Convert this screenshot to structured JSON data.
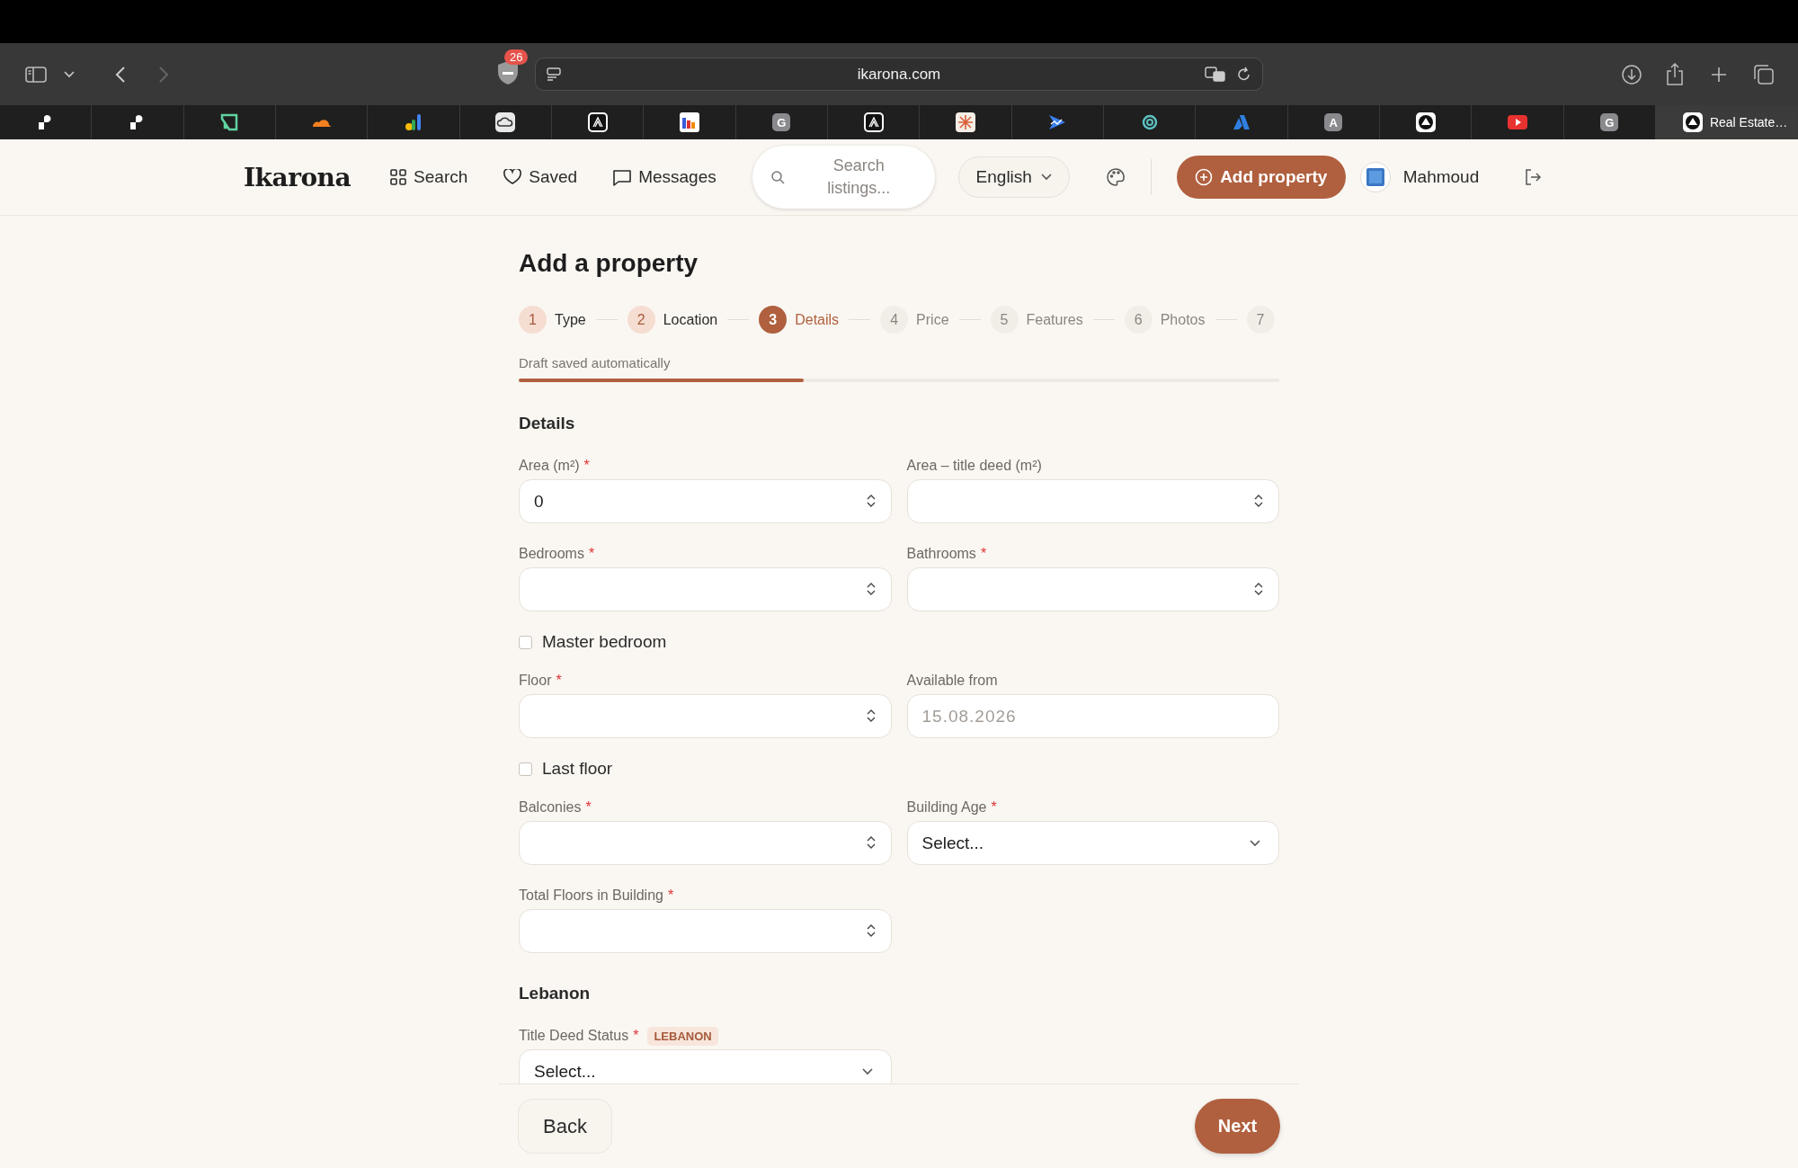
{
  "browser": {
    "address": "ikarona.com",
    "shield_badge": "26",
    "tabs": [
      {
        "kind": "blob",
        "selected": false
      },
      {
        "kind": "blob",
        "selected": false
      },
      {
        "kind": "green-square",
        "selected": false
      },
      {
        "kind": "orange-cloud",
        "selected": false
      },
      {
        "kind": "color-bars",
        "selected": false
      },
      {
        "kind": "cloud-box",
        "selected": false
      },
      {
        "kind": "mono-lines",
        "selected": false
      },
      {
        "kind": "bars-box",
        "selected": false
      },
      {
        "kind": "letter",
        "glyph": "G",
        "selected": false
      },
      {
        "kind": "mono-lines",
        "selected": false
      },
      {
        "kind": "spark",
        "selected": false
      },
      {
        "kind": "blue-arrow",
        "selected": false
      },
      {
        "kind": "teal-ring",
        "selected": false
      },
      {
        "kind": "blue-peak",
        "selected": false
      },
      {
        "kind": "letter",
        "glyph": "A",
        "selected": false
      },
      {
        "kind": "circle-triangle",
        "selected": false
      },
      {
        "kind": "play",
        "selected": false
      },
      {
        "kind": "letter",
        "glyph": "G",
        "selected": false
      },
      {
        "kind": "circle-triangle",
        "title": "Real Estate…",
        "selected": true
      }
    ]
  },
  "header": {
    "logo": "Ikarona",
    "nav": [
      {
        "kind": "grid",
        "label": "Search"
      },
      {
        "kind": "heart",
        "label": "Saved"
      },
      {
        "kind": "chat",
        "label": "Messages"
      }
    ],
    "search": {
      "placeholder": "Search listings..."
    },
    "language": "English",
    "add_button": "Add property",
    "user": "Mahmoud"
  },
  "page": {
    "title": "Add a property",
    "steps": [
      {
        "number": "1",
        "label": "Type",
        "completed": true,
        "selected": false
      },
      {
        "number": "2",
        "label": "Location",
        "completed": true,
        "selected": false
      },
      {
        "number": "3",
        "label": "Details",
        "completed": false,
        "selected": true
      },
      {
        "number": "4",
        "label": "Price",
        "completed": false,
        "selected": false
      },
      {
        "number": "5",
        "label": "Features",
        "completed": false,
        "selected": false
      },
      {
        "number": "6",
        "label": "Photos",
        "completed": false,
        "selected": false
      },
      {
        "number": "7",
        "completed": false,
        "selected": false
      }
    ],
    "draft_note": "Draft saved automatically",
    "progress": {
      "level": 0.375
    }
  },
  "sections": [
    {
      "title": "Details",
      "rows": [
        [
          {
            "kind": "number",
            "label": "Area (m²)",
            "required_mark": "*",
            "value": "0"
          },
          {
            "kind": "number",
            "label": "Area – title deed (m²)"
          }
        ],
        [
          {
            "kind": "number",
            "label": "Bedrooms",
            "required_mark": "*"
          },
          {
            "kind": "number",
            "label": "Bathrooms",
            "required_mark": "*"
          }
        ],
        [
          {
            "kind": "checkbox",
            "label": "Master bedroom",
            "checked": false
          }
        ],
        [
          {
            "kind": "number",
            "label": "Floor",
            "required_mark": "*"
          },
          {
            "kind": "date",
            "label": "Available from",
            "placeholder": "15.08.2026"
          }
        ],
        [
          {
            "kind": "checkbox",
            "label": "Last floor",
            "checked": false
          }
        ],
        [
          {
            "kind": "number",
            "label": "Balconies",
            "required_mark": "*"
          },
          {
            "kind": "select",
            "label": "Building Age",
            "required_mark": "*",
            "value": "Select..."
          }
        ],
        [
          {
            "kind": "number",
            "label": "Total Floors in Building",
            "required_mark": "*"
          }
        ]
      ]
    },
    {
      "title": "Lebanon",
      "rows": [
        [
          {
            "kind": "select",
            "label": "Title Deed Status",
            "required_mark": "*",
            "tag": "LEBANON",
            "value": "Select..."
          }
        ]
      ]
    }
  ],
  "footer": {
    "back": "Back",
    "next": "Next"
  }
}
